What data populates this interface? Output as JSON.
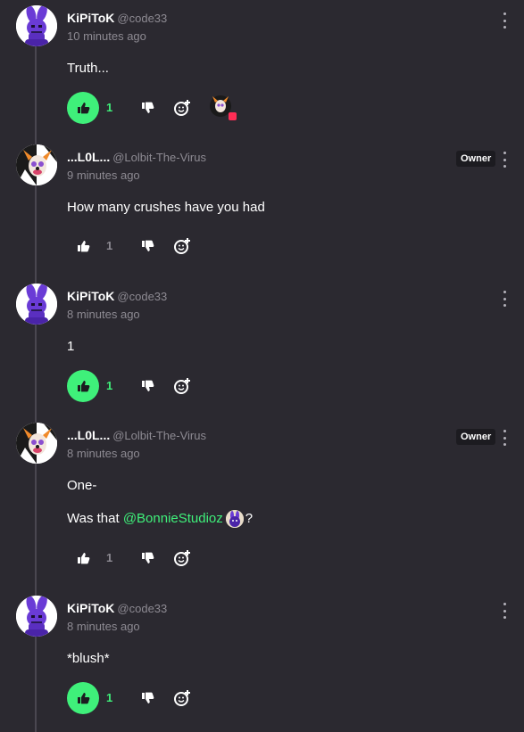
{
  "colors": {
    "background": "#2b2930",
    "accent_green": "#3ff07a",
    "muted_text": "#8d8a92"
  },
  "comments": [
    {
      "username": "KiPiToK",
      "handle": "@code33",
      "time": "10 minutes ago",
      "lines": [
        "Truth..."
      ],
      "like_count": "1",
      "liked": true,
      "has_reaction": true
    },
    {
      "username": "...L0L...",
      "handle": "@Lolbit-The-Virus",
      "time": "9 minutes ago",
      "badge": "Owner",
      "lines": [
        "How many crushes have you had"
      ],
      "like_count": "1",
      "liked": false
    },
    {
      "username": "KiPiToK",
      "handle": "@code33",
      "time": "8 minutes ago",
      "lines": [
        "1"
      ],
      "like_count": "1",
      "liked": true
    },
    {
      "username": "...L0L...",
      "handle": "@Lolbit-The-Virus",
      "time": "8 minutes ago",
      "badge": "Owner",
      "line1": "One-",
      "line2_prefix": "Was that ",
      "line2_mention": "@BonnieStudioz",
      "line2_suffix": "?",
      "like_count": "1",
      "liked": false
    },
    {
      "username": "KiPiToK",
      "handle": "@code33",
      "time": "8 minutes ago",
      "lines": [
        "*blush*"
      ],
      "like_count": "1",
      "liked": true
    }
  ],
  "icons": {
    "like": "thumbs-up-icon",
    "dislike": "thumbs-down-icon",
    "react": "add-reaction-icon",
    "more": "kebab-menu-icon"
  }
}
